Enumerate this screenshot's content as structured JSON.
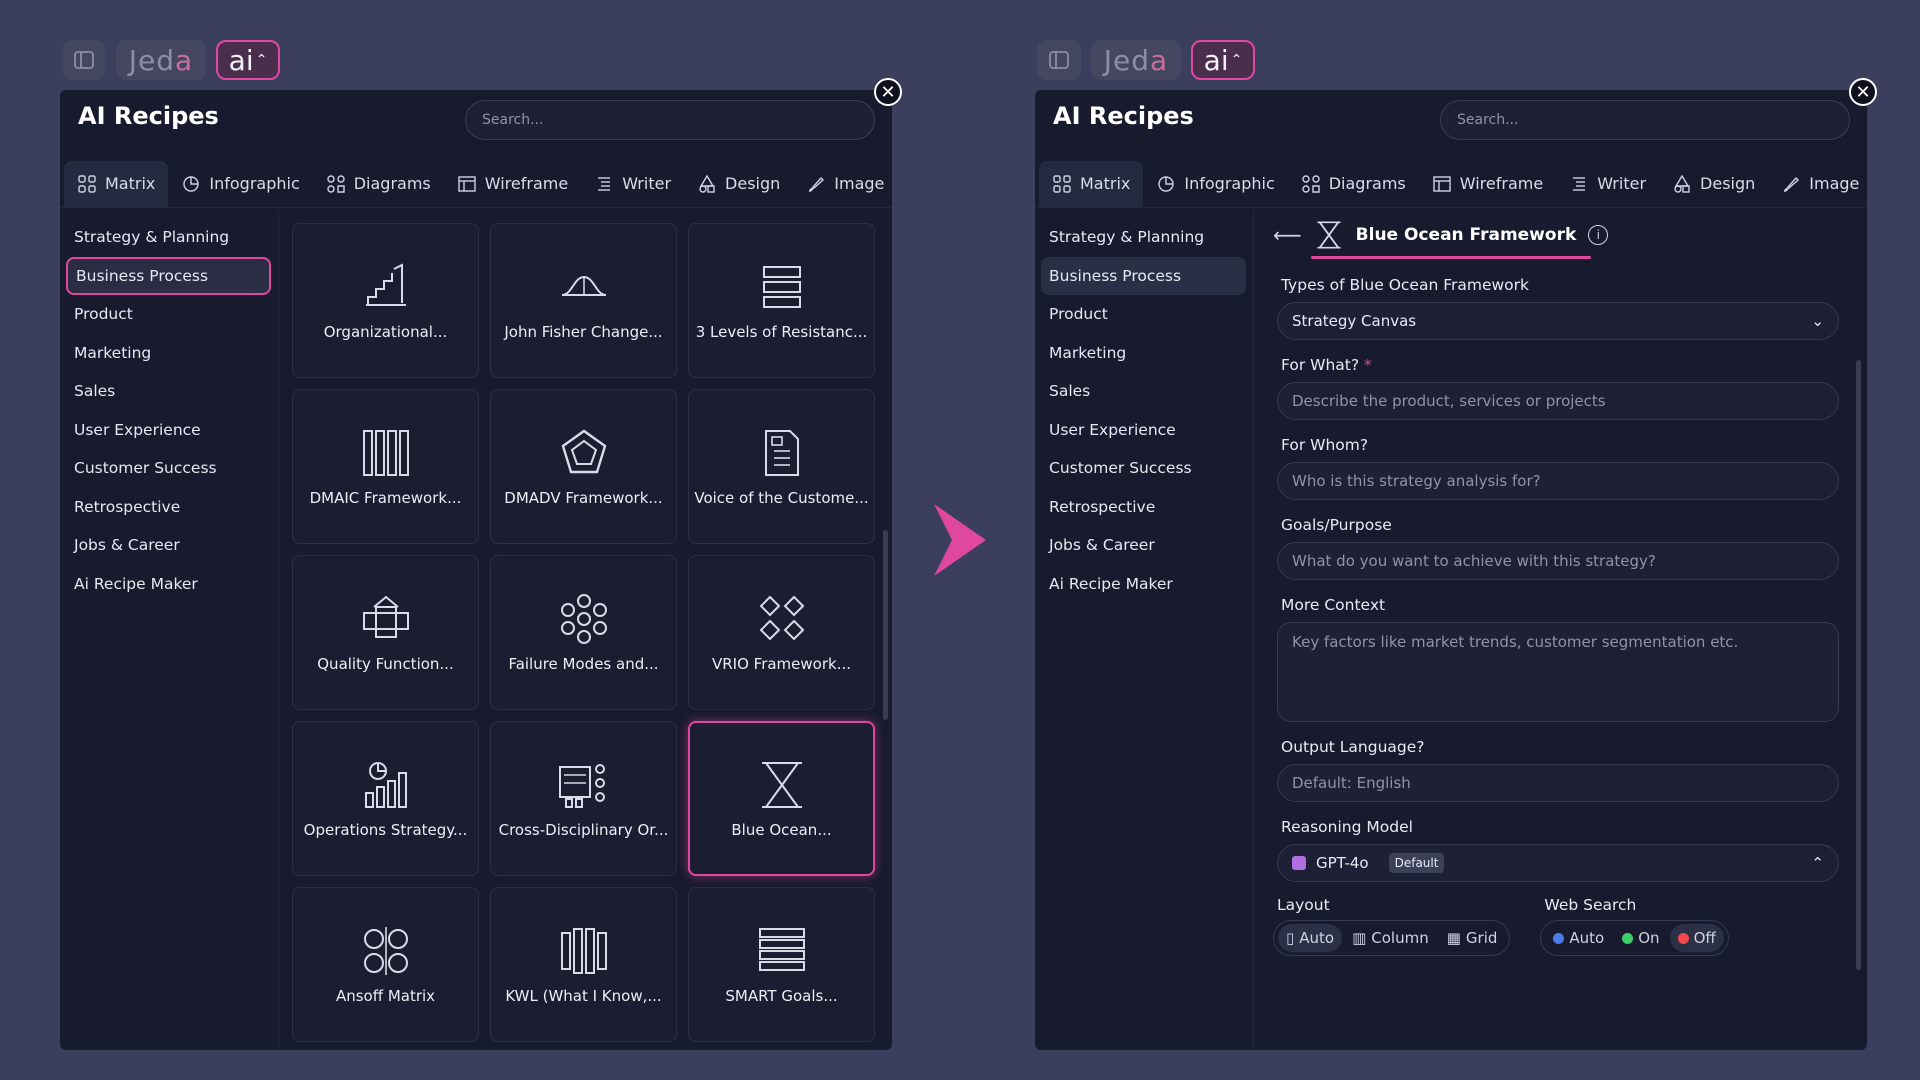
{
  "brand": {
    "text_main": "Jed",
    "text_accent": "a",
    "ai_label": "ai"
  },
  "left_panel": {
    "title": "AI Recipes",
    "search_placeholder": "Search...",
    "tabs": [
      "Matrix",
      "Infographic",
      "Diagrams",
      "Wireframe",
      "Writer",
      "Design",
      "Image"
    ],
    "categories": [
      "Strategy & Planning",
      "Business Process",
      "Product",
      "Marketing",
      "Sales",
      "User Experience",
      "Customer Success",
      "Retrospective",
      "Jobs & Career",
      "Ai Recipe Maker"
    ],
    "selected_category": "Business Process",
    "cards": [
      {
        "label": "Organizational...",
        "icon": "staircase-chart-icon"
      },
      {
        "label": "John Fisher Change...",
        "icon": "bell-curve-icon"
      },
      {
        "label": "3 Levels of Resistanc...",
        "icon": "stacked-layers-icon"
      },
      {
        "label": "DMAIC Framework...",
        "icon": "columns-icon"
      },
      {
        "label": "DMADV Framework...",
        "icon": "pentagon-icon"
      },
      {
        "label": "Voice of the Custome...",
        "icon": "document-list-icon"
      },
      {
        "label": "Quality Function...",
        "icon": "house-matrix-icon"
      },
      {
        "label": "Failure Modes and...",
        "icon": "flower-nodes-icon"
      },
      {
        "label": "VRIO Framework...",
        "icon": "diamonds-icon"
      },
      {
        "label": "Operations Strategy...",
        "icon": "growth-chart-icon"
      },
      {
        "label": "Cross-Disciplinary Or...",
        "icon": "team-board-icon"
      },
      {
        "label": "Blue Ocean...",
        "icon": "hourglass-icon"
      },
      {
        "label": "Ansoff Matrix",
        "icon": "quad-circles-icon"
      },
      {
        "label": "KWL (What I Know,...",
        "icon": "bars-icon"
      },
      {
        "label": "SMART Goals...",
        "icon": "rows-icon"
      }
    ],
    "highlighted_card": "Blue Ocean..."
  },
  "right_panel": {
    "title": "AI Recipes",
    "search_placeholder": "Search...",
    "tabs": [
      "Matrix",
      "Infographic",
      "Diagrams",
      "Wireframe",
      "Writer",
      "Design",
      "Image"
    ],
    "categories": [
      "Strategy & Planning",
      "Business Process",
      "Product",
      "Marketing",
      "Sales",
      "User Experience",
      "Customer Success",
      "Retrospective",
      "Jobs & Career",
      "Ai Recipe Maker"
    ],
    "form": {
      "title": "Blue Ocean Framework",
      "types_label": "Types of Blue Ocean Framework",
      "types_value": "Strategy Canvas",
      "for_what_label": "For What?",
      "for_what_placeholder": "Describe the product, services or projects",
      "for_whom_label": "For Whom?",
      "for_whom_placeholder": "Who is this strategy analysis for?",
      "goals_label": "Goals/Purpose",
      "goals_placeholder": "What do you want to achieve with this strategy?",
      "context_label": "More Context",
      "context_placeholder": "Key factors like market trends, customer segmentation etc.",
      "language_label": "Output Language?",
      "language_placeholder": "Default: English",
      "model_label": "Reasoning Model",
      "model_value": "GPT-4o",
      "model_badge": "Default",
      "layout_label": "Layout",
      "layout_options": [
        "Auto",
        "Column",
        "Grid"
      ],
      "web_label": "Web Search",
      "web_options": [
        "Auto",
        "On",
        "Off"
      ]
    }
  },
  "colors": {
    "accent": "#e0479e",
    "bg": "#3b3e5c",
    "panel": "#181b2d",
    "dot_auto": "#4a7cf0",
    "dot_on": "#3ecf6a",
    "dot_off": "#f04a4a"
  }
}
